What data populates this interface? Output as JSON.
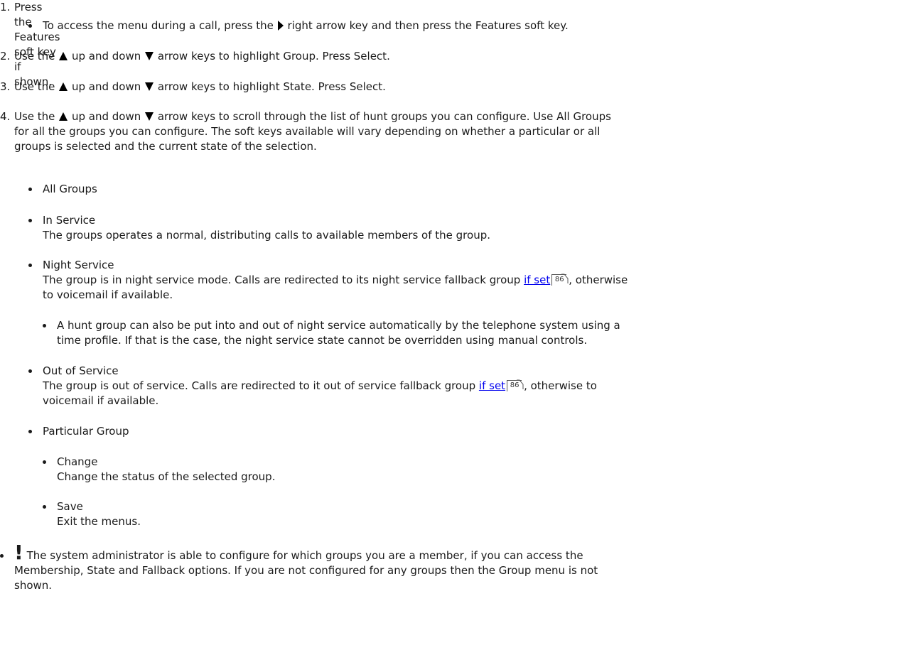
{
  "step1": {
    "num": "1.",
    "text": "Press the Features soft key if shown.",
    "sub_a": "To access the menu during a call, press the",
    "sub_b": "right arrow key and then press the Features soft key."
  },
  "step2": {
    "num": "2.",
    "a": "Use the",
    "b": "up and down",
    "c": "arrow keys to highlight Group. Press Select."
  },
  "step3": {
    "num": "3.",
    "a": "Use the",
    "b": "up and down",
    "c": "arrow keys to highlight State. Press Select."
  },
  "step4": {
    "num": "4.",
    "a": "Use the",
    "b": "up and down",
    "c": "arrow keys to scroll through the list of hunt groups you can configure. Use All Groups",
    "line2": "for all the groups you can configure. The soft keys available will vary depending on whether a particular or all",
    "line3": "groups is selected and the current state of the selection."
  },
  "all_groups": "All Groups",
  "in_service": {
    "title": "In Service",
    "desc": "The groups operates a normal, distributing calls to available members of the group."
  },
  "night_service": {
    "title": "Night Service",
    "desc1a": "The group is in night service mode. Calls are redirected to its night service fallback group",
    "link": "if set",
    "ref": "86",
    "desc1b": ", otherwise",
    "desc2": "to voicemail if available.",
    "note1": "A hunt group can also be put into and out of night service automatically by the telephone system using a",
    "note2": "time profile. If that is the case, the night service state cannot be overridden using manual controls."
  },
  "out_of_service": {
    "title": "Out of Service",
    "desc1a": "The group is out of service. Calls are redirected to it out of service fallback group",
    "link": "if set",
    "ref": "86",
    "desc1b": ", otherwise to",
    "desc2": "voicemail if available."
  },
  "particular_group": {
    "title": "Particular Group",
    "change_title": "Change",
    "change_desc": "Change the status of the selected group.",
    "save_title": "Save",
    "save_desc": "Exit the menus."
  },
  "note": {
    "bang": "!",
    "line1": "The system administrator is able to configure for which groups you are a member, if you can access the",
    "line2": "Membership, State and Fallback options. If you are not configured for any groups then the Group menu is not",
    "line3": "shown."
  },
  "icons": {
    "right": "right-arrow-icon",
    "up": "up-arrow-icon",
    "down": "down-arrow-icon",
    "ref": "page-reference-icon"
  }
}
